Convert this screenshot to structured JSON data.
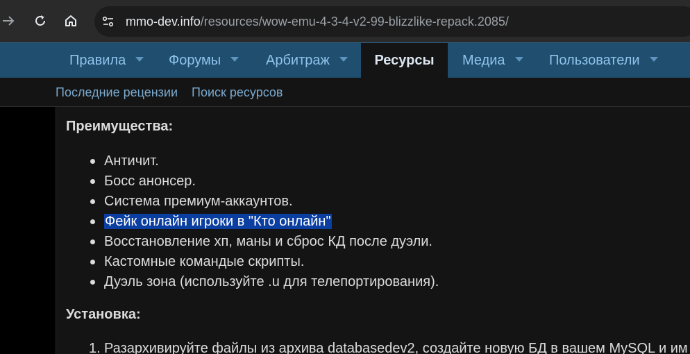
{
  "browser": {
    "url_host": "mmo-dev.info",
    "url_path": "/resources/wow-emu-4-3-4-v2-99-blizzlike-repack.2085/"
  },
  "nav": {
    "items": [
      {
        "label": "Правила",
        "has_dropdown": true
      },
      {
        "label": "Форумы",
        "has_dropdown": true
      },
      {
        "label": "Арбитраж",
        "has_dropdown": true
      },
      {
        "label": "Ресурсы",
        "has_dropdown": false,
        "active": true
      },
      {
        "label": "Медиа",
        "has_dropdown": true
      },
      {
        "label": "Пользователи",
        "has_dropdown": true
      }
    ]
  },
  "subnav": {
    "links": [
      "Последние рецензии",
      "Поиск ресурсов"
    ]
  },
  "content": {
    "advantages_heading": "Преимущества:",
    "advantages": [
      "Античит.",
      "Босс анонсер.",
      "Система премиум-аккаунтов.",
      "Фейк онлайн игроки в \"Кто онлайн\"",
      "Восстановление хп, маны и сброс КД после дуэли.",
      "Кастомные командые скрипты.",
      "Дуэль зона (используйте .u для телепортирования)."
    ],
    "highlighted_item": 3,
    "install_heading": "Установка:",
    "install_steps": [
      {
        "num": "1.",
        "text": "Разархивируйте файлы из архива databasedev2, создайте новую БД в вашем MySQL и им"
      }
    ]
  },
  "colors": {
    "nav_bg": "#1f4e6e",
    "nav_text": "#8fc3ec",
    "link": "#79a9cf",
    "selection": "#0a3ea0",
    "content_bg": "#141414"
  }
}
